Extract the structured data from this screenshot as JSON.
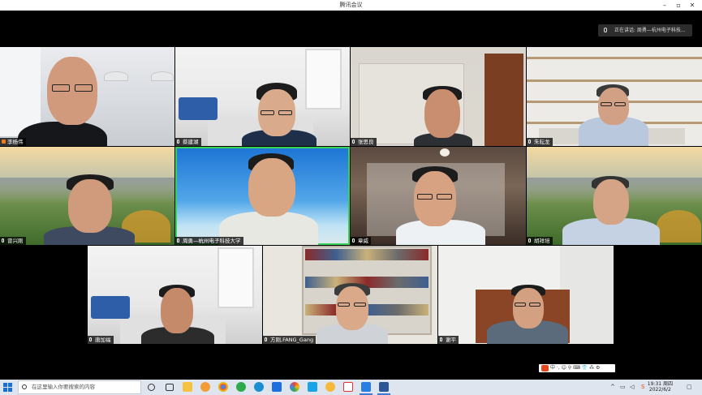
{
  "window": {
    "title": "腾讯会议",
    "controls": [
      "minimize-icon",
      "restore-icon",
      "close-icon"
    ]
  },
  "speaking_banner": {
    "text": "正在讲话: 周勇—杭州电子科技..."
  },
  "participants": [
    {
      "name": "李杨伟",
      "host": true
    },
    {
      "name": "蔡建湖"
    },
    {
      "name": "张思良"
    },
    {
      "name": "朱耘龙"
    },
    {
      "name": "曾兴刚"
    },
    {
      "name": "周勇—杭州电子科技大学"
    },
    {
      "name": "章威"
    },
    {
      "name": "胡祥培"
    },
    {
      "name": "唐加福"
    },
    {
      "name": "方刚,FANG_Gang"
    },
    {
      "name": "谢平"
    }
  ],
  "taskbar": {
    "search_placeholder": "在这里输入你要搜索的内容",
    "clock_time": "19:31 周四",
    "clock_date": "2022/6/2",
    "ime_text": "中 ·, ☺ ⚲ ⌨ 👕 ⁂ ⚙"
  }
}
